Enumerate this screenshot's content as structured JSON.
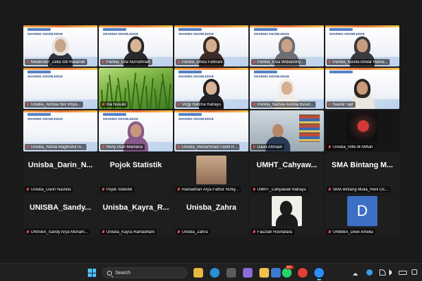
{
  "participants": [
    {
      "id": "t01",
      "name": "Moderator_Zella Siti Hasanah",
      "tile": "banner",
      "speaking": true,
      "skin": "#c8a48a",
      "hijab": "#e6e1dc",
      "shirt": "#2e3440",
      "banner_text": "SHARING KNOWLEDGE"
    },
    {
      "id": "t02",
      "name": "Panitia_Dila Nurrahmah",
      "tile": "banner",
      "skin": "#d9b396",
      "hijab": "#2a2a2e",
      "shirt": "#2a2a2e",
      "banner_text": "SHARING KNOWLEDGE"
    },
    {
      "id": "t03",
      "name": "Panitia_Dhea Febriani",
      "tile": "banner",
      "skin": "#d6ad8f",
      "hijab": "#3b2b26",
      "shirt": "#3b2b26",
      "banner_text": "SHARING KNOWLEDGE"
    },
    {
      "id": "t04",
      "name": "Panitia_Elsa Widiandriy...",
      "tile": "banner",
      "skin": "#caa187",
      "hijab": "#6e6e73",
      "shirt": "#6e6e73",
      "banner_text": "SHARING KNOWLEDGE"
    },
    {
      "id": "t05",
      "name": "Panitia_Novita Anwar Rama...",
      "tile": "banner",
      "skin": "#c79d80",
      "hijab": "#3a3a3f",
      "shirt": "#3a3a3f",
      "banner_text": "SHARING KNOWLEDGE"
    },
    {
      "id": "t06",
      "name": "Unisba_Annisa Nur Intiya...",
      "tile": "banner-empty",
      "banner_text": "SHARING KNOWLEDGE"
    },
    {
      "id": "t07",
      "name": "Ina Nusuki",
      "tile": "green"
    },
    {
      "id": "t08",
      "name": "Virgy Rahma Rahayu",
      "tile": "banner",
      "skin": "#d8b395",
      "hijab": "#222226",
      "shirt": "#222226",
      "banner_text": "SHARING KNOWLEDGE"
    },
    {
      "id": "t09",
      "name": "Panitia_Nazwa Aurelia Ba'ad...",
      "tile": "banner",
      "skin": "#d6ae92",
      "hijab": "#f1ede6",
      "shirt": "#f1ede6",
      "banner_text": "SHARING KNOWLEDGE"
    },
    {
      "id": "t10",
      "name": "Naufal Tajir",
      "tile": "banner",
      "skin": "#c99a7b",
      "hijab": "#2d2722",
      "shirt": "#e9e5df",
      "banner_text": ""
    },
    {
      "id": "t11",
      "name": "Unisba_Adzila Magfirotul In...",
      "tile": "banner-empty",
      "banner_text": "SHARING KNOWLEDGE"
    },
    {
      "id": "t12",
      "name": "Reny Rian Marliana",
      "tile": "banner",
      "skin": "#c7987a",
      "hijab": "#8a5a8a",
      "shirt": "#8a5a8a",
      "banner_text": "SHARING KNOWLEDGE"
    },
    {
      "id": "t13",
      "name": "Unisba_Muhammad Fadhl R...",
      "tile": "banner-empty",
      "banner_text": "SHARING KNOWLEDGE"
    },
    {
      "id": "t14",
      "name": "Daud Ahmadi",
      "tile": "room"
    },
    {
      "id": "t15",
      "name": "Unisba_Rifki M Miftah",
      "tile": "photo-dark"
    },
    {
      "id": "t16",
      "name": "Unisba_Darin Nashita",
      "tile": "dark",
      "big": "Unisba_Darin_N..."
    },
    {
      "id": "t17",
      "name": "Pojok Statistik",
      "tile": "dark",
      "big": "Pojok Statistik"
    },
    {
      "id": "t18",
      "name": "Ramadhan Arya Fathur Rizky...",
      "tile": "avatar"
    },
    {
      "id": "t19",
      "name": "UMHT_Cahyawati Rahayu",
      "tile": "dark",
      "big": "UMHT_Cahyaw..."
    },
    {
      "id": "t20",
      "name": "SMA Bintang Mulia_Reni Oc...",
      "tile": "dark",
      "big": "SMA Bintang M..."
    },
    {
      "id": "t21",
      "name": "UNISBA_Sandy Arya Muham...",
      "tile": "dark",
      "big": "UNISBA_Sandy..."
    },
    {
      "id": "t22",
      "name": "Unisba_Kayra Ramadhani",
      "tile": "dark",
      "big": "Unisba_Kayra_R..."
    },
    {
      "id": "t23",
      "name": "Unisba_Zahra",
      "tile": "dark",
      "big": "Unisba_Zahra"
    },
    {
      "id": "t24",
      "name": "Fauziah Roshafara",
      "tile": "silhouette"
    },
    {
      "id": "t25",
      "name": "UNIBBA_Dewi Amelia",
      "tile": "letter",
      "letter": "D",
      "letter_color": "#3d6fc7"
    }
  ],
  "taskbar": {
    "search_placeholder": "Search",
    "notification_badge": "99+",
    "apps": [
      {
        "name": "file-explorer-icon",
        "color": "#e8b93c"
      },
      {
        "name": "edge-icon",
        "color": "#2b8fd6"
      },
      {
        "name": "gallery-icon",
        "color": "#5a5a5a"
      },
      {
        "name": "copilot-icon",
        "color": "#8a6bd8"
      },
      {
        "name": "folder-icon",
        "color": "#f0c24b"
      },
      {
        "name": "store-icon",
        "color": "#3c7bd4"
      },
      {
        "name": "whatsapp-icon",
        "color": "#25d366"
      },
      {
        "name": "chrome-icon",
        "color": "#e34133"
      },
      {
        "name": "zoom-icon",
        "color": "#2d8cff"
      }
    ]
  }
}
